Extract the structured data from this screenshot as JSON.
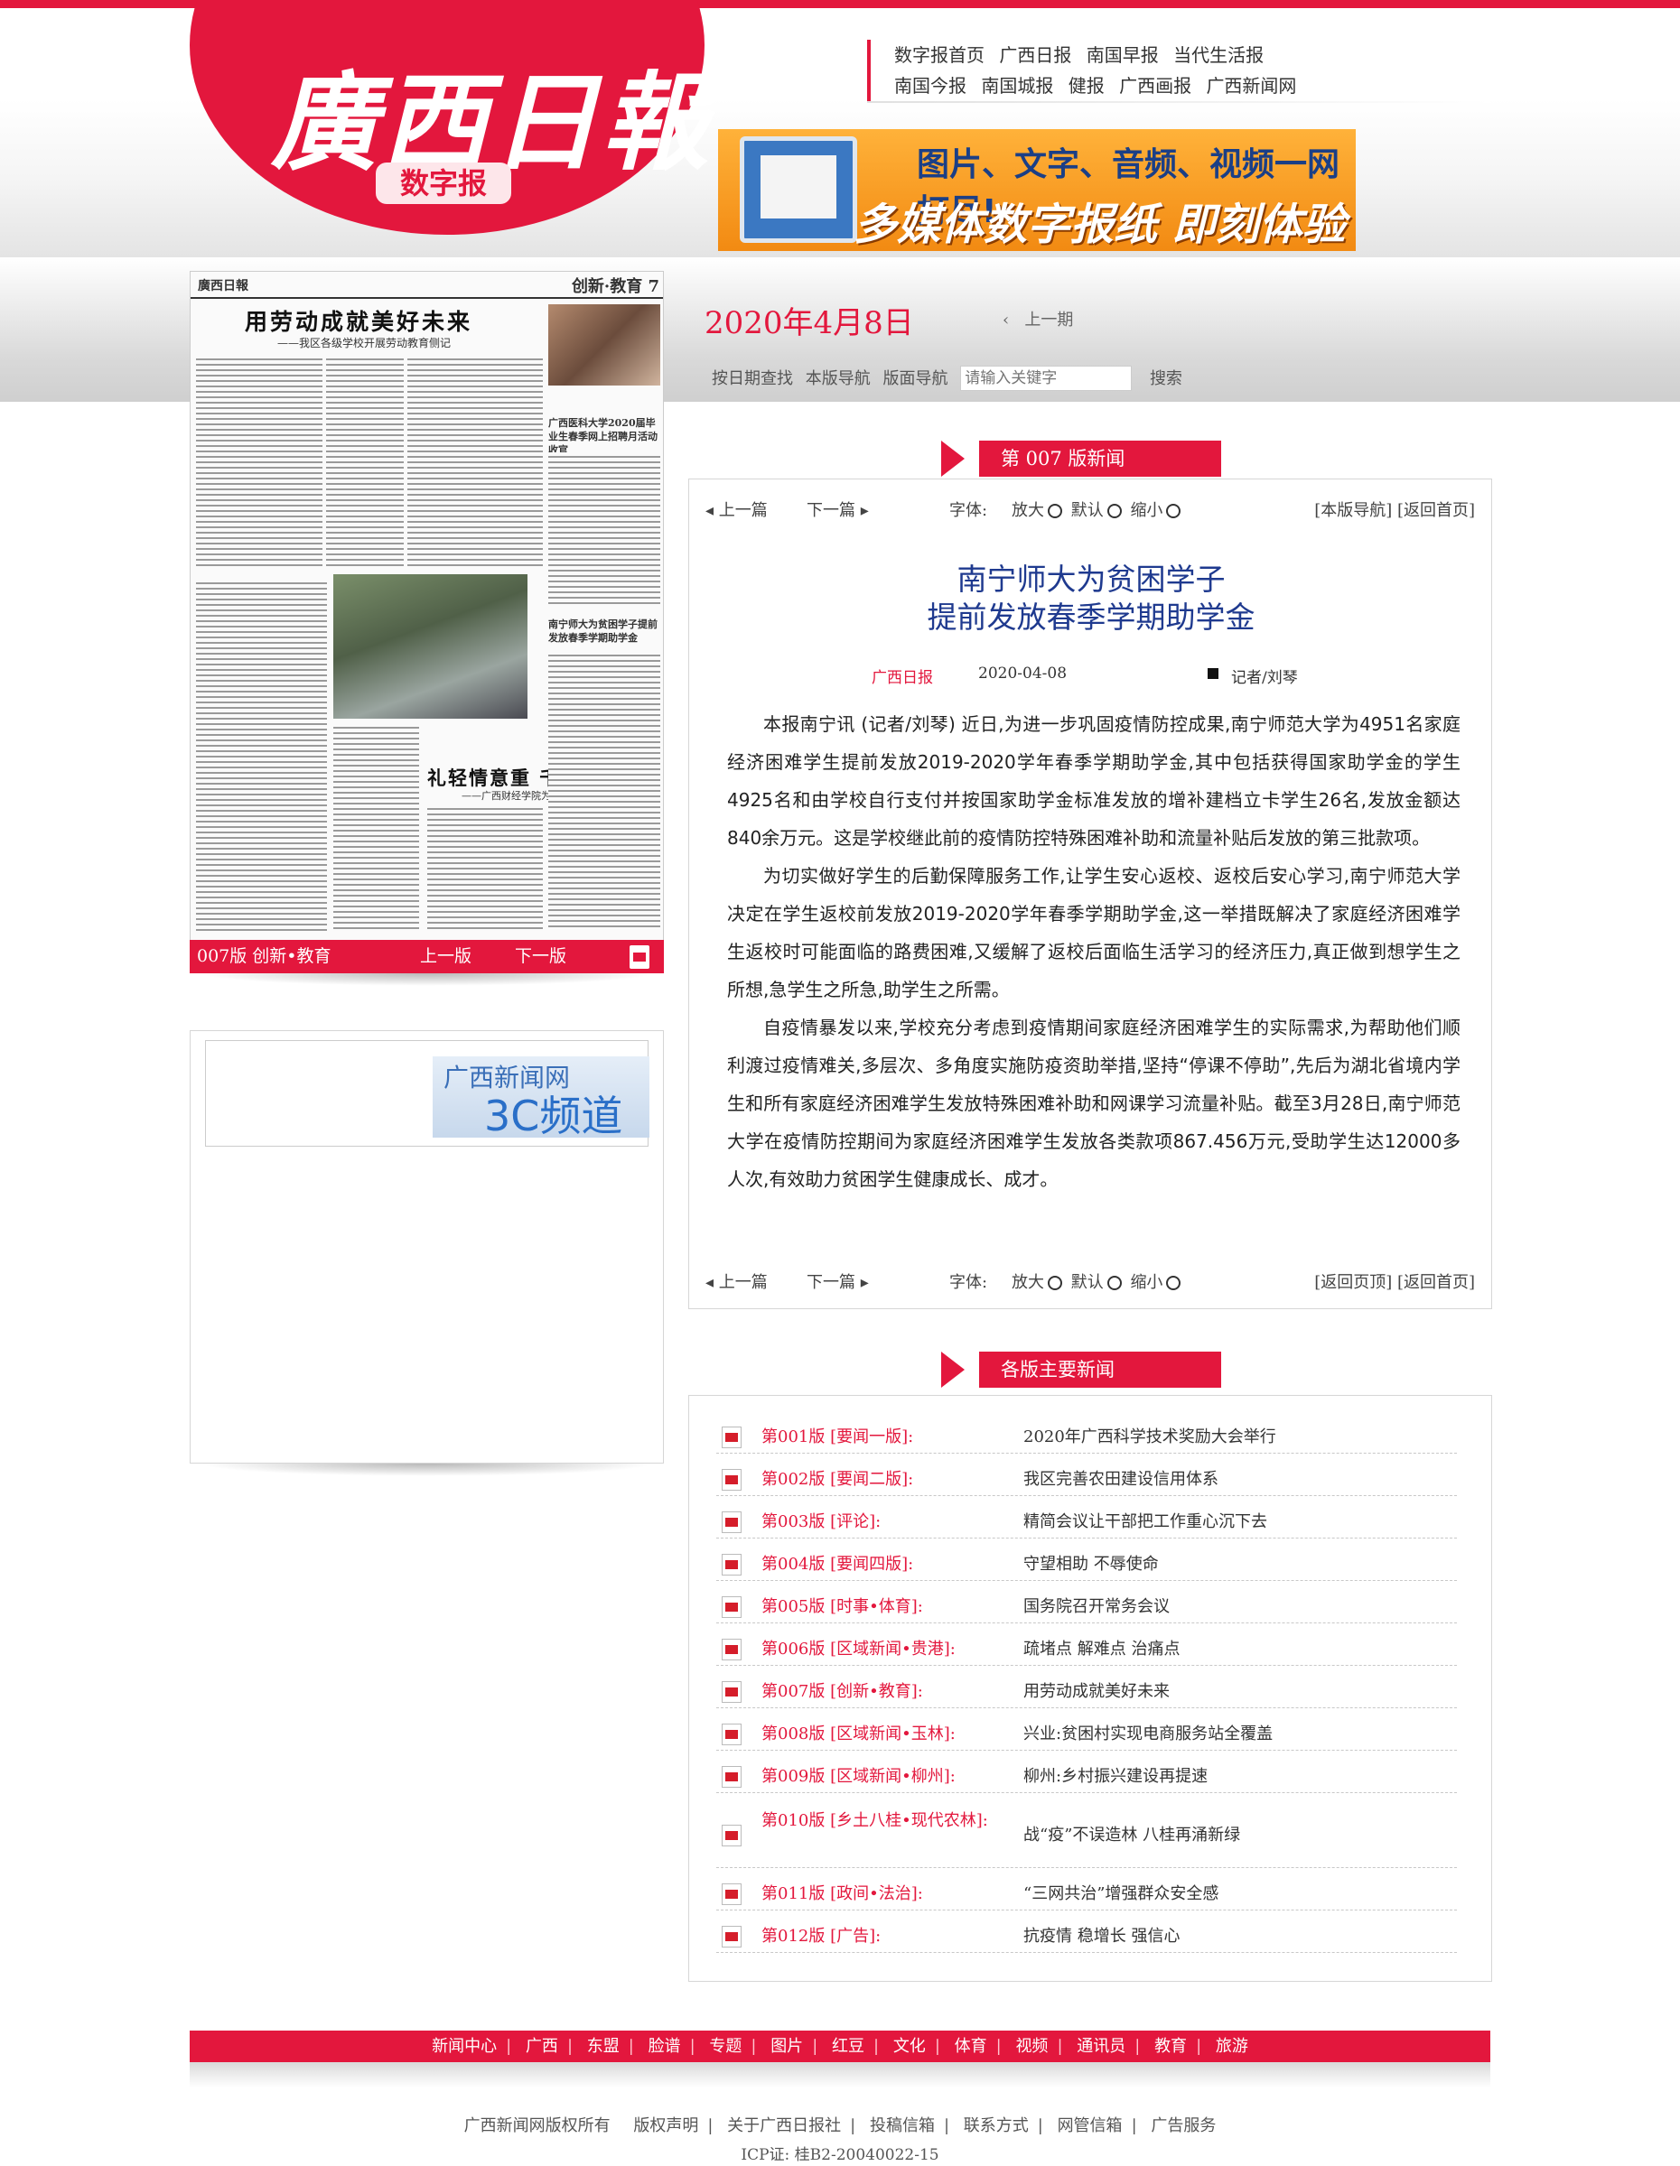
{
  "logo": {
    "name": "廣西日報",
    "sub": "数字报"
  },
  "topnav": {
    "row1": [
      "数字报首页",
      "广西日报",
      "南国早报",
      "当代生活报"
    ],
    "row2": [
      "南国今报",
      "南国城报",
      "健报",
      "广西画报",
      "广西新闻网"
    ]
  },
  "banner": {
    "line1": "图片、文字、音频、视频一网打尽!",
    "line2": "多媒体数字报纸  即刻体验"
  },
  "paper": {
    "masthead": "廣西日報",
    "section": "创新·教育 7",
    "headline1": "用劳动成就美好未来",
    "subhead1": "——我区各级学校开展劳动教育侧记",
    "side1": "广西医科大学2020届毕业生春季网上招聘月活动收官",
    "side2": "南宁师大为贫困学子提前发放春季学期助学金",
    "headline2": "礼轻情意重  千里送平安",
    "subhead2": "——广西财经学院为海内外学子寄送爱心口罩",
    "bar_edition": "007版 创新•教育",
    "bar_prev": "上一版",
    "bar_next": "下一版"
  },
  "box3c": {
    "line1": "广西新闻网",
    "line2": "3C频道"
  },
  "date": {
    "current": "2020年4月8日",
    "prev": "上一期",
    "by_date": "按日期查找",
    "page_nav": "本版导航",
    "layout_nav": "版面导航",
    "search_placeholder": "请输入关键字",
    "search_btn": "搜索"
  },
  "section_tab": {
    "label": "第 007 版新闻"
  },
  "tools": {
    "prev": "上一篇",
    "next": "下一篇",
    "font_label": "字体:",
    "bigger": "放大",
    "default": "默认",
    "smaller": "缩小",
    "top_right": "[本版导航] [返回首页]",
    "bottom_right": "[返回页顶] [返回首页]"
  },
  "article": {
    "title_line1": "南宁师大为贫困学子",
    "title_line2": "提前发放春季学期助学金",
    "source": "广西日报",
    "date": "2020-04-08",
    "author": "记者/刘琴",
    "paragraphs": [
      "本报南宁讯 (记者/刘琴) 近日,为进一步巩固疫情防控成果,南宁师范大学为4951名家庭经济困难学生提前发放2019-2020学年春季学期助学金,其中包括获得国家助学金的学生4925名和由学校自行支付并按国家助学金标准发放的增补建档立卡学生26名,发放金额达840余万元。这是学校继此前的疫情防控特殊困难补助和流量补贴后发放的第三批款项。",
      "为切实做好学生的后勤保障服务工作,让学生安心返校、返校后安心学习,南宁师范大学决定在学生返校前发放2019-2020学年春季学期助学金,这一举措既解决了家庭经济困难学生返校时可能面临的路费困难,又缓解了返校后面临生活学习的经济压力,真正做到想学生之所想,急学生之所急,助学生之所需。",
      "自疫情暴发以来,学校充分考虑到疫情期间家庭经济困难学生的实际需求,为帮助他们顺利渡过疫情难关,多层次、多角度实施防疫资助举措,坚持“停课不停助”,先后为湖北省境内学生和所有家庭经济困难学生发放特殊困难补助和网课学习流量补贴。截至3月28日,南宁师范大学在疫情防控期间为家庭经济困难学生发放各类款项867.456万元,受助学生达12000多人次,有效助力贫困学生健康成长、成才。"
    ]
  },
  "news_tab": {
    "label": "各版主要新闻"
  },
  "news": [
    {
      "edition": "第001版 [要闻一版]:",
      "title": "2020年广西科学技术奖励大会举行"
    },
    {
      "edition": "第002版 [要闻二版]:",
      "title": "我区完善农田建设信用体系"
    },
    {
      "edition": "第003版 [评论]:",
      "title": "精简会议让干部把工作重心沉下去"
    },
    {
      "edition": "第004版 [要闻四版]:",
      "title": "守望相助 不辱使命"
    },
    {
      "edition": "第005版 [时事•体育]:",
      "title": "国务院召开常务会议"
    },
    {
      "edition": "第006版 [区域新闻•贵港]:",
      "title": "疏堵点 解难点 治痛点"
    },
    {
      "edition": "第007版 [创新•教育]:",
      "title": "用劳动成就美好未来"
    },
    {
      "edition": "第008版 [区域新闻•玉林]:",
      "title": "兴业:贫困村实现电商服务站全覆盖"
    },
    {
      "edition": "第009版 [区域新闻•柳州]:",
      "title": "柳州:乡村振兴建设再提速"
    },
    {
      "edition": "第010版 [乡土八桂•现代农林]:",
      "title": "战“疫”不误造林 八桂再涌新绿"
    },
    {
      "edition": "第011版 [政间•法治]:",
      "title": "“三网共治”增强群众安全感"
    },
    {
      "edition": "第012版 [广告]:",
      "title": "抗疫情 稳增长 强信心"
    }
  ],
  "footnav": [
    "新闻中心",
    "广西",
    "东盟",
    "脸谱",
    "专题",
    "图片",
    "红豆",
    "文化",
    "体育",
    "视频",
    "通讯员",
    "教育",
    "旅游"
  ],
  "copyright": [
    "广西新闻网版权所有",
    "版权声明",
    "关于广西日报社",
    "投稿信箱",
    "联系方式",
    "网管信箱",
    "广告服务"
  ],
  "icp": "ICP证: 桂B2-20040022-15",
  "colors": {
    "brand_red": "#e3173d",
    "title_blue": "#1f3a8f"
  }
}
